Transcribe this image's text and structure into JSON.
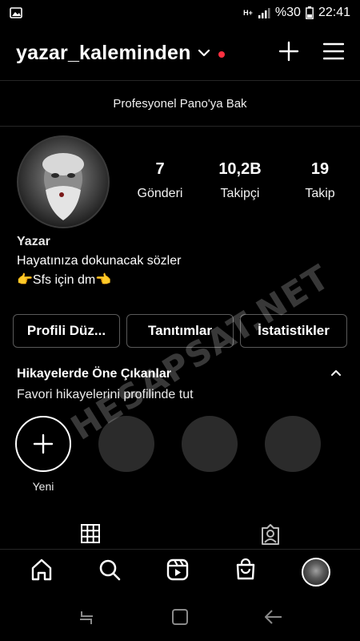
{
  "status_bar": {
    "network": "H+",
    "battery_percent": "%30",
    "time": "22:41"
  },
  "header": {
    "username": "yazar_kaleminden"
  },
  "professional_dashboard": {
    "label": "Profesyonel Pano'ya Bak"
  },
  "profile": {
    "stats": [
      {
        "value": "7",
        "label": "Gönderi"
      },
      {
        "value": "10,2B",
        "label": "Takipçi"
      },
      {
        "value": "19",
        "label": "Takip"
      }
    ],
    "name": "Yazar",
    "bio_line1": "Hayatınıza dokunacak sözler",
    "bio_line2": "👉Sfs için dm👈"
  },
  "buttons": {
    "edit_profile": "Profili Düz...",
    "promotions": "Tanıtımlar",
    "insights": "İstatistikler"
  },
  "highlights": {
    "title": "Hikayelerde Öne Çıkanlar",
    "subtitle": "Favori hikayelerini profilinde tut",
    "new_label": "Yeni"
  },
  "watermark": "HESAPSAT.NET",
  "colors": {
    "notification_dot": "#ff3040",
    "button_border": "#5a5a5a",
    "divider": "#262626"
  }
}
